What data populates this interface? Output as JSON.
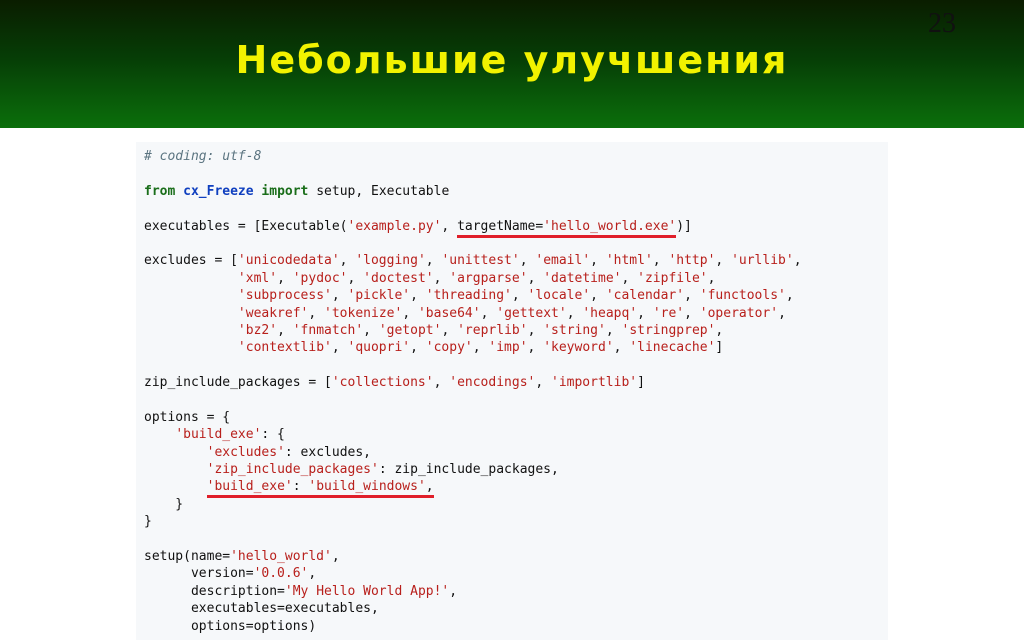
{
  "slide": {
    "title": "Небольшие улучшения",
    "number": "23"
  },
  "code": {
    "lines": [
      [
        {
          "t": "# coding: utf-8",
          "c": "c"
        }
      ],
      [],
      [
        {
          "t": "from",
          "c": "k"
        },
        {
          "t": " "
        },
        {
          "t": "cx_Freeze",
          "c": "n"
        },
        {
          "t": " "
        },
        {
          "t": "import",
          "c": "k"
        },
        {
          "t": " setup, Executable"
        }
      ],
      [],
      [
        {
          "t": "executables = [Executable("
        },
        {
          "t": "'example.py'",
          "c": "s"
        },
        {
          "t": ", "
        },
        {
          "t": "targetName=",
          "u": true
        },
        {
          "t": "'hello_world.exe'",
          "c": "s",
          "u": true
        },
        {
          "t": ")]"
        }
      ],
      [],
      [
        {
          "t": "excludes = ["
        },
        {
          "t": "'unicodedata'",
          "c": "s"
        },
        {
          "t": ", "
        },
        {
          "t": "'logging'",
          "c": "s"
        },
        {
          "t": ", "
        },
        {
          "t": "'unittest'",
          "c": "s"
        },
        {
          "t": ", "
        },
        {
          "t": "'email'",
          "c": "s"
        },
        {
          "t": ", "
        },
        {
          "t": "'html'",
          "c": "s"
        },
        {
          "t": ", "
        },
        {
          "t": "'http'",
          "c": "s"
        },
        {
          "t": ", "
        },
        {
          "t": "'urllib'",
          "c": "s"
        },
        {
          "t": ","
        }
      ],
      [
        {
          "t": "            "
        },
        {
          "t": "'xml'",
          "c": "s"
        },
        {
          "t": ", "
        },
        {
          "t": "'pydoc'",
          "c": "s"
        },
        {
          "t": ", "
        },
        {
          "t": "'doctest'",
          "c": "s"
        },
        {
          "t": ", "
        },
        {
          "t": "'argparse'",
          "c": "s"
        },
        {
          "t": ", "
        },
        {
          "t": "'datetime'",
          "c": "s"
        },
        {
          "t": ", "
        },
        {
          "t": "'zipfile'",
          "c": "s"
        },
        {
          "t": ","
        }
      ],
      [
        {
          "t": "            "
        },
        {
          "t": "'subprocess'",
          "c": "s"
        },
        {
          "t": ", "
        },
        {
          "t": "'pickle'",
          "c": "s"
        },
        {
          "t": ", "
        },
        {
          "t": "'threading'",
          "c": "s"
        },
        {
          "t": ", "
        },
        {
          "t": "'locale'",
          "c": "s"
        },
        {
          "t": ", "
        },
        {
          "t": "'calendar'",
          "c": "s"
        },
        {
          "t": ", "
        },
        {
          "t": "'functools'",
          "c": "s"
        },
        {
          "t": ","
        }
      ],
      [
        {
          "t": "            "
        },
        {
          "t": "'weakref'",
          "c": "s"
        },
        {
          "t": ", "
        },
        {
          "t": "'tokenize'",
          "c": "s"
        },
        {
          "t": ", "
        },
        {
          "t": "'base64'",
          "c": "s"
        },
        {
          "t": ", "
        },
        {
          "t": "'gettext'",
          "c": "s"
        },
        {
          "t": ", "
        },
        {
          "t": "'heapq'",
          "c": "s"
        },
        {
          "t": ", "
        },
        {
          "t": "'re'",
          "c": "s"
        },
        {
          "t": ", "
        },
        {
          "t": "'operator'",
          "c": "s"
        },
        {
          "t": ","
        }
      ],
      [
        {
          "t": "            "
        },
        {
          "t": "'bz2'",
          "c": "s"
        },
        {
          "t": ", "
        },
        {
          "t": "'fnmatch'",
          "c": "s"
        },
        {
          "t": ", "
        },
        {
          "t": "'getopt'",
          "c": "s"
        },
        {
          "t": ", "
        },
        {
          "t": "'reprlib'",
          "c": "s"
        },
        {
          "t": ", "
        },
        {
          "t": "'string'",
          "c": "s"
        },
        {
          "t": ", "
        },
        {
          "t": "'stringprep'",
          "c": "s"
        },
        {
          "t": ","
        }
      ],
      [
        {
          "t": "            "
        },
        {
          "t": "'contextlib'",
          "c": "s"
        },
        {
          "t": ", "
        },
        {
          "t": "'quopri'",
          "c": "s"
        },
        {
          "t": ", "
        },
        {
          "t": "'copy'",
          "c": "s"
        },
        {
          "t": ", "
        },
        {
          "t": "'imp'",
          "c": "s"
        },
        {
          "t": ", "
        },
        {
          "t": "'keyword'",
          "c": "s"
        },
        {
          "t": ", "
        },
        {
          "t": "'linecache'",
          "c": "s"
        },
        {
          "t": "]"
        }
      ],
      [],
      [
        {
          "t": "zip_include_packages = ["
        },
        {
          "t": "'collections'",
          "c": "s"
        },
        {
          "t": ", "
        },
        {
          "t": "'encodings'",
          "c": "s"
        },
        {
          "t": ", "
        },
        {
          "t": "'importlib'",
          "c": "s"
        },
        {
          "t": "]"
        }
      ],
      [],
      [
        {
          "t": "options = {"
        }
      ],
      [
        {
          "t": "    "
        },
        {
          "t": "'build_exe'",
          "c": "s"
        },
        {
          "t": ": {"
        }
      ],
      [
        {
          "t": "        "
        },
        {
          "t": "'excludes'",
          "c": "s"
        },
        {
          "t": ": excludes,"
        }
      ],
      [
        {
          "t": "        "
        },
        {
          "t": "'zip_include_packages'",
          "c": "s"
        },
        {
          "t": ": zip_include_packages,"
        }
      ],
      [
        {
          "t": "        "
        },
        {
          "t": "'build_exe'",
          "c": "s",
          "u": true
        },
        {
          "t": ": ",
          "u": true
        },
        {
          "t": "'build_windows'",
          "c": "s",
          "u": true
        },
        {
          "t": ",",
          "u": true
        }
      ],
      [
        {
          "t": "    }"
        }
      ],
      [
        {
          "t": "}"
        }
      ],
      [],
      [
        {
          "t": "setup(name="
        },
        {
          "t": "'hello_world'",
          "c": "s"
        },
        {
          "t": ","
        }
      ],
      [
        {
          "t": "      version="
        },
        {
          "t": "'0.0.6'",
          "c": "s"
        },
        {
          "t": ","
        }
      ],
      [
        {
          "t": "      description="
        },
        {
          "t": "'My Hello World App!'",
          "c": "s"
        },
        {
          "t": ","
        }
      ],
      [
        {
          "t": "      executables=executables,"
        }
      ],
      [
        {
          "t": "      options=options)"
        }
      ]
    ]
  }
}
